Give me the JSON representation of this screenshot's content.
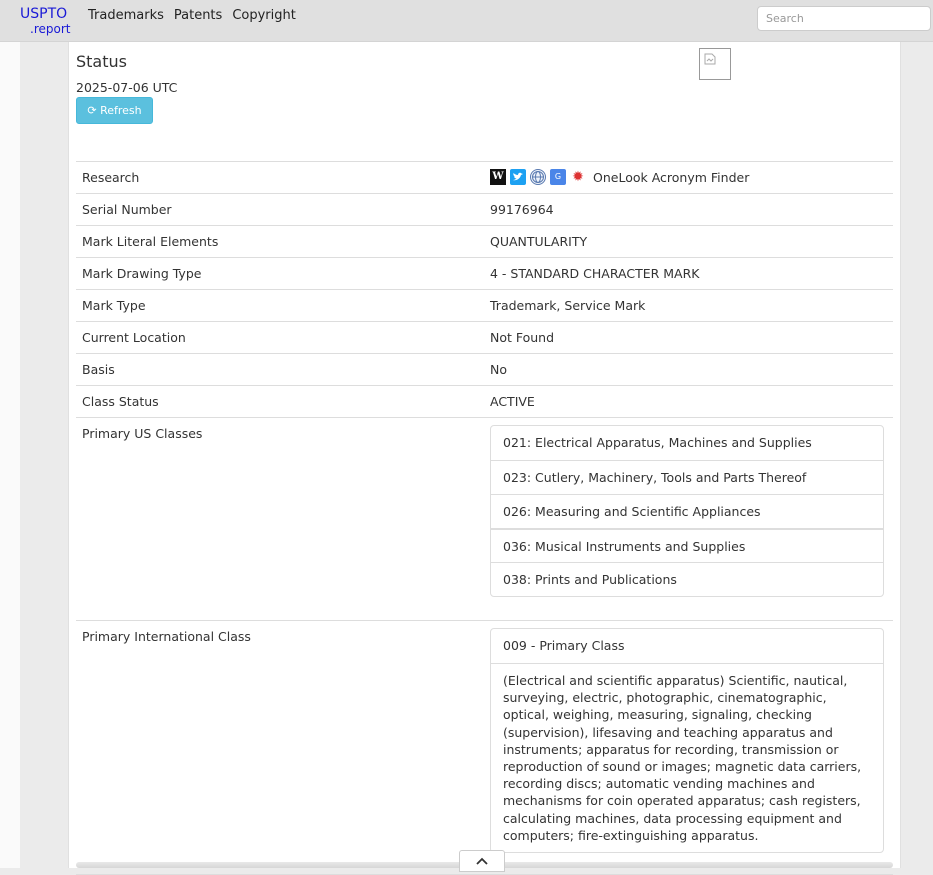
{
  "brand": {
    "top": "USPTO",
    "bottom": ".report"
  },
  "nav": [
    "Trademarks",
    "Patents",
    "Copyright"
  ],
  "search": {
    "placeholder": "Search",
    "value": ""
  },
  "status": {
    "title": "Status",
    "date": "2025-07-06 UTC",
    "refresh_label": "⟳ Refresh"
  },
  "research": {
    "label": "Research",
    "icons": [
      "wikipedia-icon",
      "twitter-icon",
      "globe-icon",
      "google-translate-icon",
      "onelook-icon"
    ],
    "onelook_text": "OneLook Acronym Finder"
  },
  "fields": [
    {
      "label": "Serial Number",
      "value": "99176964"
    },
    {
      "label": "Mark Literal Elements",
      "value": "QUANTULARITY"
    },
    {
      "label": "Mark Drawing Type",
      "value": "4 - STANDARD CHARACTER MARK"
    },
    {
      "label": "Mark Type",
      "value": "Trademark, Service Mark"
    },
    {
      "label": "Current Location",
      "value": "Not Found"
    },
    {
      "label": "Basis",
      "value": "No"
    },
    {
      "label": "Class Status",
      "value": "ACTIVE"
    }
  ],
  "us_classes": {
    "label": "Primary US Classes",
    "items": [
      "021: Electrical Apparatus, Machines and Supplies",
      "023: Cutlery, Machinery, Tools and Parts Thereof",
      "026: Measuring and Scientific Appliances",
      "036: Musical Instruments and Supplies",
      "038: Prints and Publications"
    ]
  },
  "intl_class": {
    "label": "Primary International Class",
    "heading": "009 - Primary Class",
    "description": "(Electrical and scientific apparatus) Scientific, nautical, surveying, electric, photographic, cinematographic, optical, weighing, measuring, signaling, checking (supervision), lifesaving and teaching apparatus and instruments; apparatus for recording, transmission or reproduction of sound or images; magnetic data carriers, recording discs; automatic vending machines and mechanisms for coin operated apparatus; cash registers, calculating machines, data processing equipment and computers; fire-extinguishing apparatus."
  },
  "colors": {
    "brand": "#1a1ad6",
    "refresh_button": "#5bc0de",
    "navbar": "#e0e0e0"
  }
}
